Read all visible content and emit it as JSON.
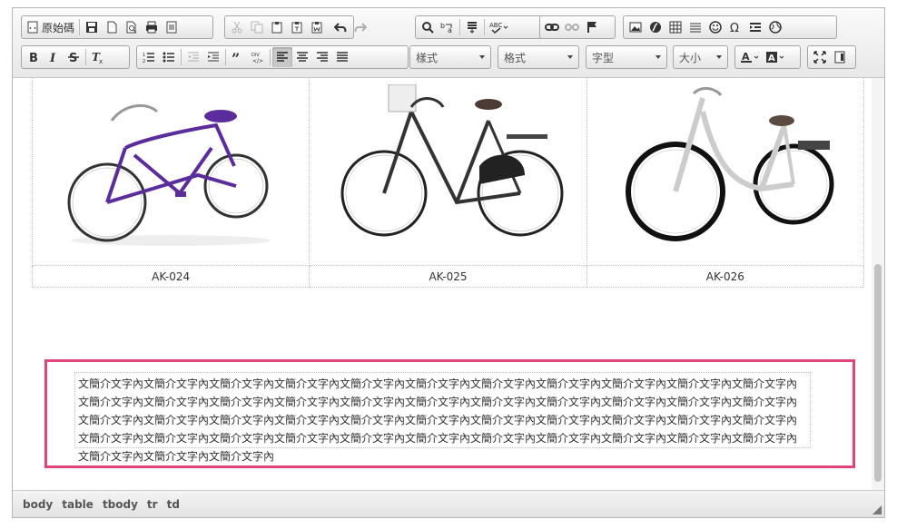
{
  "toolbar": {
    "row1": {
      "source_label": "原始碼"
    },
    "row2": {
      "styles_combo": "樣式",
      "format_combo": "格式",
      "font_combo": "字型",
      "size_combo": "大小"
    }
  },
  "products": [
    {
      "code": "AK-024",
      "icon": "purple-cruiser-bicycle"
    },
    {
      "code": "AK-025",
      "icon": "black-dutch-bicycle"
    },
    {
      "code": "AK-026",
      "icon": "white-city-bicycle"
    }
  ],
  "description": "文簡介文字內文簡介文字內文簡介文字內文簡介文字內文簡介文字內文簡介文字內文簡介文字內文簡介文字內文簡介文字內文簡介文字內文簡介文字內文簡介文字內文簡介文字內文簡介文字內文簡介文字內文簡介文字內文簡介文字內文簡介文字內文簡介文字內文簡介文字內文簡介文字內文簡介文字內文簡介文字內文簡介文字內文簡介文字內文簡介文字內文簡介文字內文簡介文字內文簡介文字內文簡介文字內文簡介文字內文簡介文字內文簡介文字內文簡介文字內文簡介文字內文簡介文字內文簡介文字內文簡介文字內文簡介文字內文簡介文字內文簡介文字內文簡介文字內文簡介文字內文簡介文字內文簡介文字內文簡介文字內文簡介文字內",
  "statusbar": {
    "path": [
      "body",
      "table",
      "tbody",
      "tr",
      "td"
    ]
  },
  "colors": {
    "highlight": "#e1457a",
    "purple_bike": "#5b2d9c"
  }
}
